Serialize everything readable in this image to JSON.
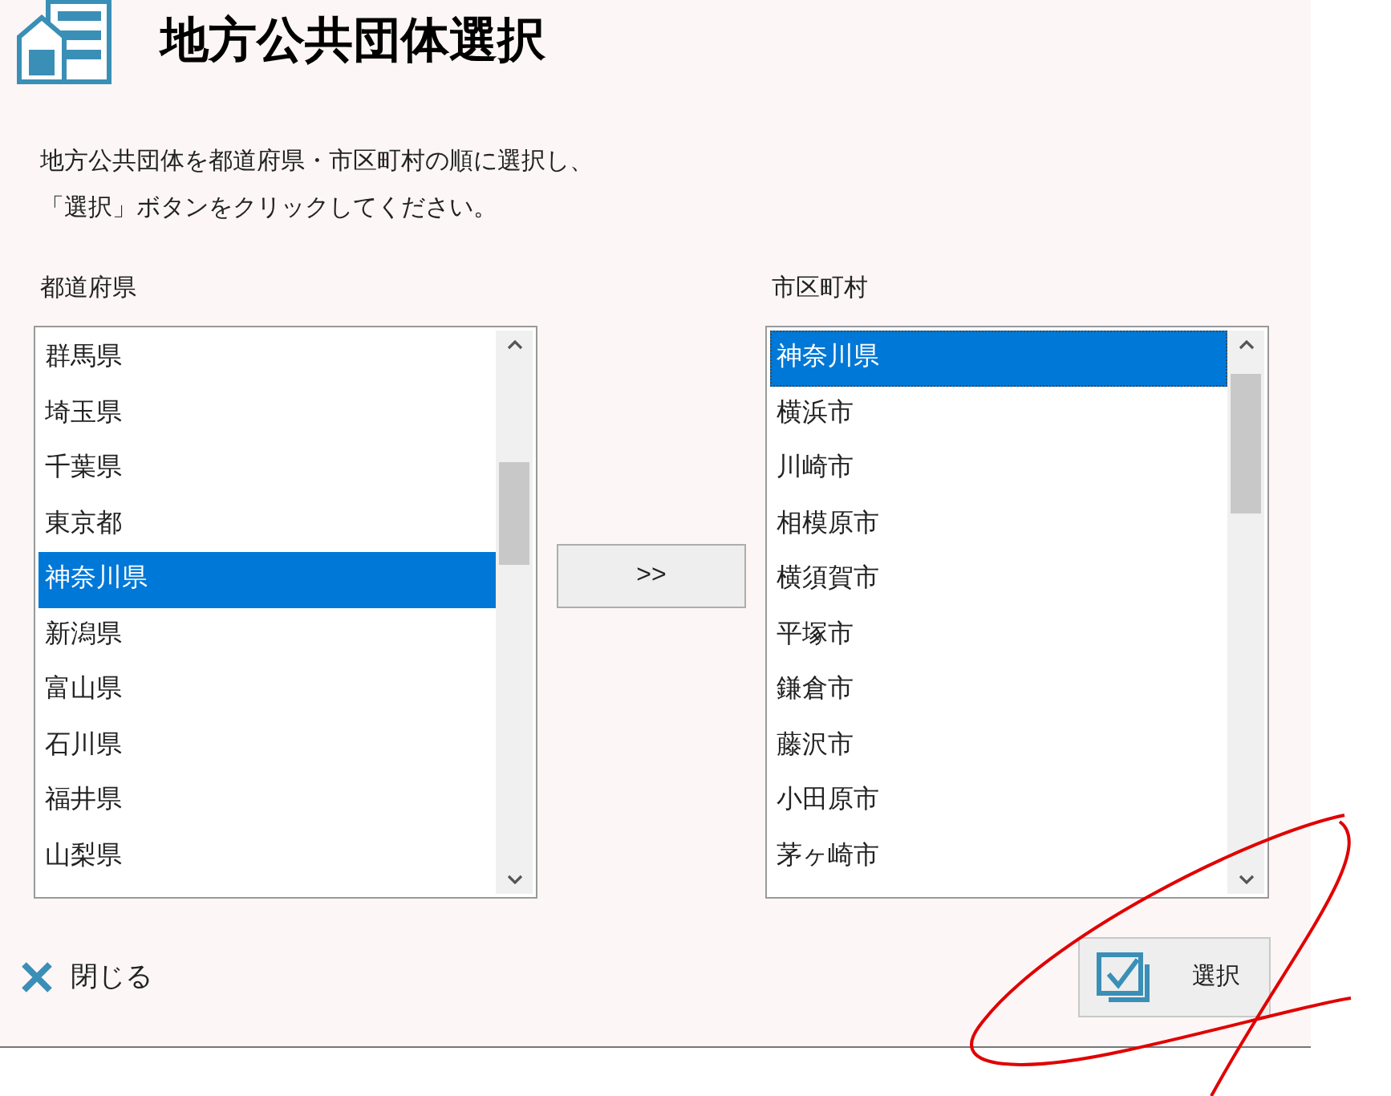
{
  "title": "地方公共団体選択",
  "instructions": [
    "地方公共団体を都道府県・市区町村の順に選択し、",
    "「選択」ボタンをクリックしてください。"
  ],
  "prefecture_list": {
    "label": "都道府県",
    "focused": false,
    "items": [
      {
        "text": "群馬県",
        "selected": false
      },
      {
        "text": "埼玉県",
        "selected": false
      },
      {
        "text": "千葉県",
        "selected": false
      },
      {
        "text": "東京都",
        "selected": false
      },
      {
        "text": "神奈川県",
        "selected": true
      },
      {
        "text": "新潟県",
        "selected": false
      },
      {
        "text": "富山県",
        "selected": false
      },
      {
        "text": "石川県",
        "selected": false
      },
      {
        "text": "福井県",
        "selected": false
      },
      {
        "text": "山梨県",
        "selected": false
      }
    ]
  },
  "transfer_button": ">>",
  "municipality_list": {
    "label": "市区町村",
    "focused": true,
    "items": [
      {
        "text": "神奈川県",
        "selected": true
      },
      {
        "text": "横浜市",
        "selected": false
      },
      {
        "text": "川崎市",
        "selected": false
      },
      {
        "text": "相模原市",
        "selected": false
      },
      {
        "text": "横須賀市",
        "selected": false
      },
      {
        "text": "平塚市",
        "selected": false
      },
      {
        "text": "鎌倉市",
        "selected": false
      },
      {
        "text": "藤沢市",
        "selected": false
      },
      {
        "text": "小田原市",
        "selected": false
      },
      {
        "text": "茅ヶ崎市",
        "selected": false
      }
    ]
  },
  "close_button": "閉じる",
  "select_button": "選択"
}
